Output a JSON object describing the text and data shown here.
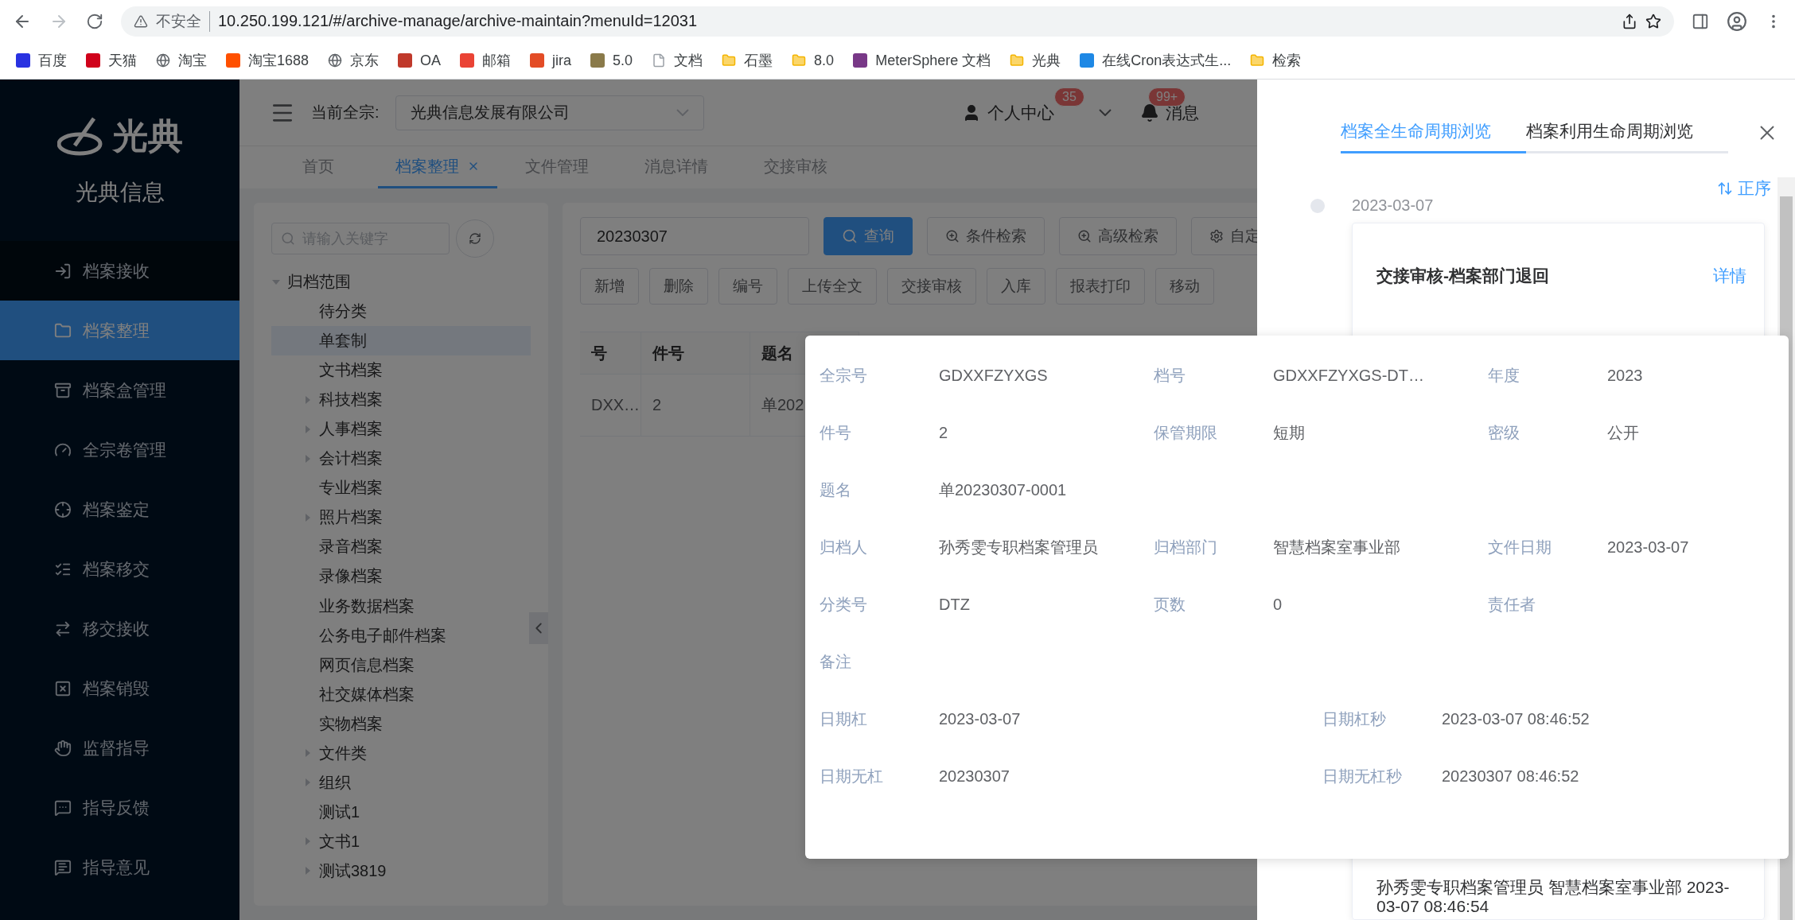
{
  "browser": {
    "security": "不安全",
    "url": "10.250.199.121/#/archive-manage/archive-maintain?menuId=12031",
    "bookmarks": [
      {
        "label": "百度",
        "kind": "logo",
        "color": "#2932e1"
      },
      {
        "label": "天猫",
        "kind": "logo",
        "color": "#d0021b"
      },
      {
        "label": "淘宝",
        "kind": "globe"
      },
      {
        "label": "淘宝1688",
        "kind": "logo",
        "color": "#ff5000"
      },
      {
        "label": "京东",
        "kind": "globe"
      },
      {
        "label": "OA",
        "kind": "logo",
        "color": "#c0392b"
      },
      {
        "label": "邮箱",
        "kind": "logo",
        "color": "#ea4335"
      },
      {
        "label": "jira",
        "kind": "logo",
        "color": "#e34c26"
      },
      {
        "label": "5.0",
        "kind": "logo",
        "color": "#8a7a4a"
      },
      {
        "label": "文档",
        "kind": "page"
      },
      {
        "label": "石墨",
        "kind": "folder"
      },
      {
        "label": "8.0",
        "kind": "folder"
      },
      {
        "label": "MeterSphere 文档",
        "kind": "logo",
        "color": "#783887"
      },
      {
        "label": "光典",
        "kind": "folder"
      },
      {
        "label": "在线Cron表达式生...",
        "kind": "logo",
        "color": "#1e88e5"
      },
      {
        "label": "检索",
        "kind": "folder"
      }
    ]
  },
  "sidebar": {
    "brand": "光典",
    "company": "光典信息",
    "items": [
      {
        "label": "档案接收",
        "selected": false
      },
      {
        "label": "档案整理",
        "selected": true
      },
      {
        "label": "档案盒管理",
        "selected": false
      },
      {
        "label": "全宗卷管理",
        "selected": false
      },
      {
        "label": "档案鉴定",
        "selected": false
      },
      {
        "label": "档案移交",
        "selected": false
      },
      {
        "label": "移交接收",
        "selected": false
      },
      {
        "label": "档案销毁",
        "selected": false
      },
      {
        "label": "监督指导",
        "selected": false
      },
      {
        "label": "指导反馈",
        "selected": false
      },
      {
        "label": "指导意见",
        "selected": false
      }
    ]
  },
  "header": {
    "fonds_label": "当前全宗:",
    "fonds_value": "光典信息发展有限公司",
    "user": "个人中心",
    "user_badge": "35",
    "messages": "消息",
    "messages_badge": "99+"
  },
  "tabs": [
    {
      "label": "首页",
      "selected": false,
      "closable": false
    },
    {
      "label": "档案整理",
      "selected": true,
      "closable": true
    },
    {
      "label": "文件管理",
      "selected": false,
      "closable": false
    },
    {
      "label": "消息详情",
      "selected": false,
      "closable": false
    },
    {
      "label": "交接审核",
      "selected": false,
      "closable": false
    }
  ],
  "tree": {
    "placeholder": "请输入关键字",
    "items": [
      {
        "label": "归档范围",
        "expanded": true,
        "selected": false,
        "children": [
          {
            "label": "待分类",
            "selected": false
          },
          {
            "label": "单套制",
            "selected": true
          },
          {
            "label": "文书档案",
            "selected": false
          },
          {
            "label": "科技档案",
            "selected": false,
            "expanded": false
          },
          {
            "label": "人事档案",
            "selected": false,
            "expanded": false
          },
          {
            "label": "会计档案",
            "selected": false,
            "expanded": false
          },
          {
            "label": "专业档案",
            "selected": false
          },
          {
            "label": "照片档案",
            "selected": false,
            "expanded": false
          },
          {
            "label": "录音档案",
            "selected": false
          },
          {
            "label": "录像档案",
            "selected": false
          },
          {
            "label": "业务数据档案",
            "selected": false
          },
          {
            "label": "公务电子邮件档案",
            "selected": false
          },
          {
            "label": "网页信息档案",
            "selected": false
          },
          {
            "label": "社交媒体档案",
            "selected": false
          },
          {
            "label": "实物档案",
            "selected": false
          },
          {
            "label": "文件类",
            "selected": false,
            "expanded": false
          },
          {
            "label": "组织",
            "selected": false,
            "expanded": false
          },
          {
            "label": "测试1",
            "selected": false
          },
          {
            "label": "文书1",
            "selected": false,
            "expanded": false
          },
          {
            "label": "测试3819",
            "selected": false,
            "expanded": false
          }
        ]
      }
    ]
  },
  "search": {
    "value": "20230307",
    "query_button": "查询",
    "buttons": [
      "条件检索",
      "高级检索",
      "自定"
    ]
  },
  "actions": [
    "新增",
    "删除",
    "编号",
    "上传全文",
    "交接审核",
    "入库",
    "报表打印",
    "移动"
  ],
  "table": {
    "columns": [
      "号",
      "件号",
      "题名"
    ],
    "rows": [
      [
        "DXX…",
        "2",
        "单202"
      ]
    ]
  },
  "drawer": {
    "tabs": [
      {
        "label": "档案全生命周期浏览",
        "selected": true
      },
      {
        "label": "档案利用生命周期浏览",
        "selected": false
      }
    ],
    "sort": "正序",
    "date": "2023-03-07",
    "card_title": "交接审核-档案部门退回",
    "card_link": "详情",
    "card_footer": "孙秀雯专职档案管理员 智慧档案室事业部 2023-03-07 08:46:54"
  },
  "popover": {
    "rows": [
      {
        "kind": "thirds",
        "fields": [
          {
            "label": "全宗号",
            "value": "GDXXFZYXGS"
          },
          {
            "label": "档号",
            "value": "GDXXFZYXGS-DT…"
          },
          {
            "label": "年度",
            "value": "2023"
          }
        ]
      },
      {
        "kind": "thirds",
        "fields": [
          {
            "label": "件号",
            "value": "2"
          },
          {
            "label": "保管期限",
            "value": "短期"
          },
          {
            "label": "密级",
            "value": "公开"
          }
        ]
      },
      {
        "kind": "thirds",
        "fields": [
          {
            "label": "题名",
            "value": "单20230307-0001"
          }
        ]
      },
      {
        "kind": "thirds",
        "fields": [
          {
            "label": "归档人",
            "value": "孙秀雯专职档案管理员"
          },
          {
            "label": "归档部门",
            "value": "智慧档案室事业部"
          },
          {
            "label": "文件日期",
            "value": "2023-03-07"
          }
        ]
      },
      {
        "kind": "thirds",
        "fields": [
          {
            "label": "分类号",
            "value": "DTZ"
          },
          {
            "label": "页数",
            "value": "0"
          },
          {
            "label": "责任者"
          }
        ]
      },
      {
        "kind": "thirds",
        "fields": [
          {
            "label": "备注"
          }
        ]
      },
      {
        "kind": "halves",
        "fields": [
          {
            "label": "日期杠",
            "value": "2023-03-07"
          },
          {
            "label": "日期杠秒",
            "value": "2023-03-07 08:46:52"
          }
        ]
      },
      {
        "kind": "halves",
        "fields": [
          {
            "label": "日期无杠",
            "value": "20230307"
          },
          {
            "label": "日期无杠秒",
            "value": "20230307 08:46:52"
          }
        ]
      }
    ]
  }
}
